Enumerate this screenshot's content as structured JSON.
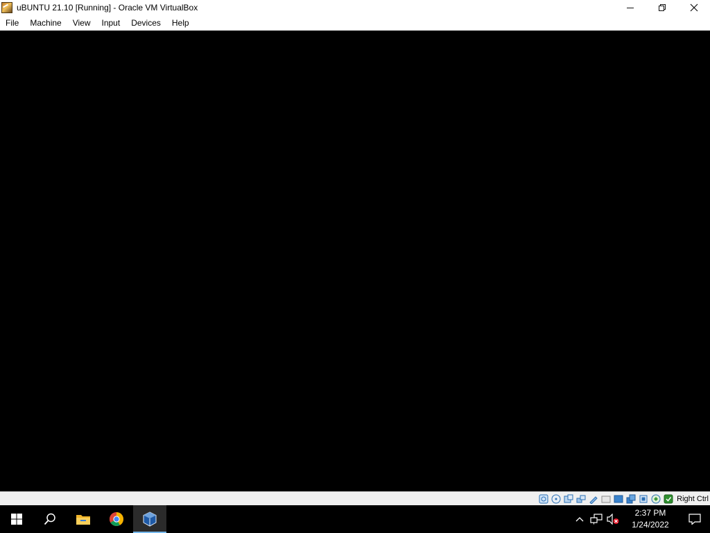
{
  "window": {
    "title": "uBUNTU 21.10 [Running] - Oracle VM VirtualBox",
    "icon": "virtualbox-vm-icon",
    "controls": [
      "minimize-icon",
      "restore-icon",
      "close-icon"
    ]
  },
  "menubar": {
    "items": [
      {
        "label": "File"
      },
      {
        "label": "Machine"
      },
      {
        "label": "View"
      },
      {
        "label": "Input"
      },
      {
        "label": "Devices"
      },
      {
        "label": "Help"
      }
    ]
  },
  "statusbar": {
    "icons": [
      "hard-disk-icon",
      "optical-drive-icon",
      "audio-icon",
      "network-icon",
      "usb-icon",
      "shared-folders-icon",
      "display-icon",
      "video-capture-icon",
      "vt-x-icon",
      "mouse-integration-icon",
      "cpu-icon",
      "host-key-icon"
    ],
    "host_key": "Right Ctrl"
  },
  "taskbar": {
    "apps": [
      {
        "name": "start",
        "icon": "windows-start-icon"
      },
      {
        "name": "search",
        "icon": "search-icon"
      },
      {
        "name": "file-explorer",
        "icon": "folder-icon"
      },
      {
        "name": "chrome",
        "icon": "chrome-icon"
      },
      {
        "name": "virtualbox",
        "icon": "virtualbox-icon",
        "active": true
      }
    ],
    "tray": {
      "icons": [
        "chevron-up-icon",
        "network-icon",
        "volume-muted-icon"
      ],
      "time": "2:37 PM",
      "date": "1/24/2022"
    }
  },
  "colors": {
    "taskbar": "#000000",
    "accent": "#76b9ed",
    "statusbar": "#f0f0f0"
  }
}
